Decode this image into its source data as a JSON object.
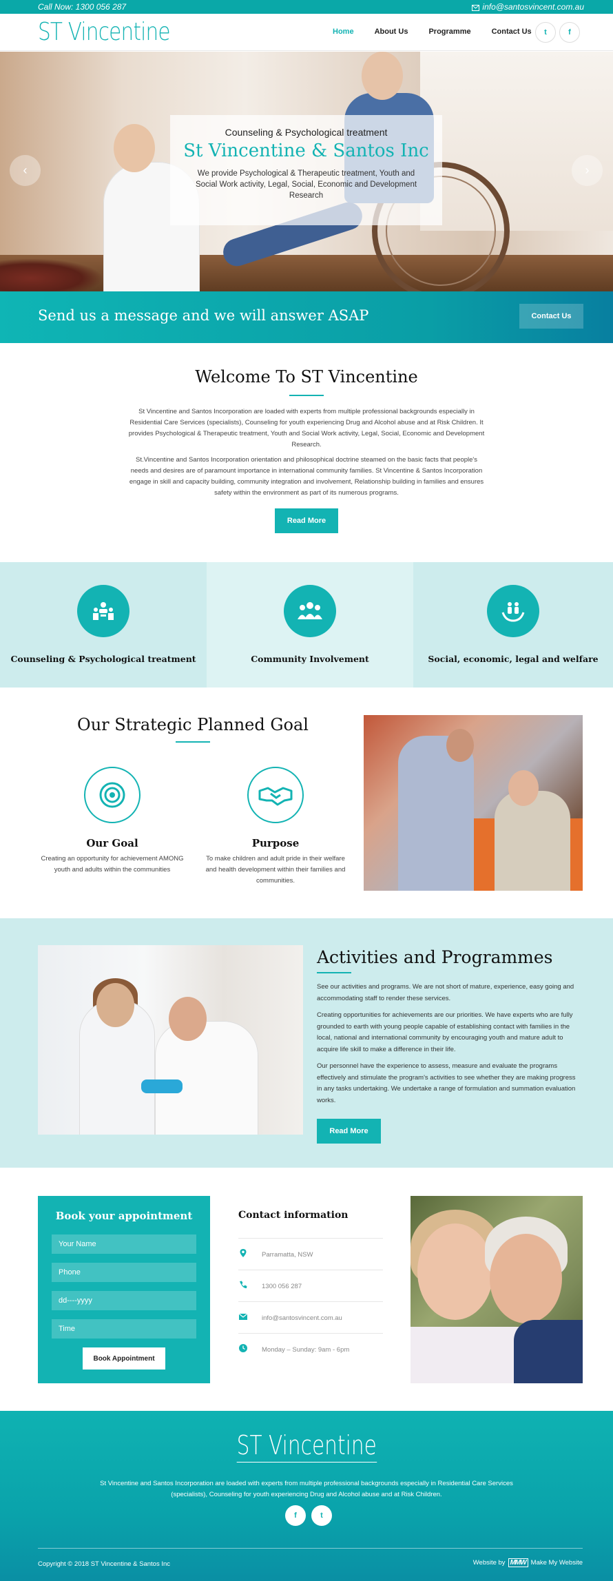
{
  "topbar": {
    "call": "Call Now: 1300 056 287",
    "email": "info@santosvincent.com.au"
  },
  "header": {
    "logo": "ST Vincentine",
    "nav": [
      "Home",
      "About Us",
      "Programme",
      "Contact Us"
    ],
    "active_nav": "Home",
    "social": [
      "twitter-icon",
      "facebook-icon"
    ],
    "social_glyphs": {
      "twitter": "t",
      "facebook": "f"
    }
  },
  "hero": {
    "subtitle": "Counseling & Psychological treatment",
    "title": "St Vincentine & Santos Inc",
    "description": "We provide Psychological & Therapeutic treatment, Youth and Social Work activity, Legal, Social, Economic and Development Research",
    "prev": "‹",
    "next": "›"
  },
  "cta": {
    "message": "Send us a message and we will answer ASAP",
    "button": "Contact Us"
  },
  "welcome": {
    "title": "Welcome To ST Vincentine",
    "p1": "St Vincentine and Santos Incorporation are loaded with experts from multiple professional backgrounds especially in Residential Care Services (specialists), Counseling for youth experiencing Drug and Alcohol abuse and at Risk Children. It provides Psychological & Therapeutic treatment, Youth and Social Work activity, Legal, Social, Economic and Development Research.",
    "p2": "St.Vincentine and Santos Incorporation orientation and philosophical doctrine steamed on the basic facts that people's needs and desires are of paramount importance in international community families. St Vincentine & Santos Incorporation engage in skill and capacity building, community integration and involvement, Relationship building in families and ensures safety within the environment as part of its numerous programs.",
    "button": "Read More"
  },
  "features": [
    {
      "label": "Counseling & Psychological treatment",
      "icon": "counseling-icon"
    },
    {
      "label": "Community Involvement",
      "icon": "community-icon"
    },
    {
      "label": "Social, economic, legal and welfare",
      "icon": "welfare-icon"
    }
  ],
  "goal": {
    "title": "Our Strategic Planned Goal",
    "items": [
      {
        "title": "Our Goal",
        "text": "Creating an opportunity for achievement AMONG youth and adults within the communities",
        "icon": "target-icon"
      },
      {
        "title": "Purpose",
        "text": "To make children and adult pride in their welfare and health development within their families and communities.",
        "icon": "handshake-icon"
      }
    ]
  },
  "activities": {
    "title": "Activities and Programmes",
    "p1": "See our activities and programs. We are not short of mature, experience, easy going and accommodating staff to render these services.",
    "p2": "Creating opportunities for achievements are our priorities. We have experts who are fully grounded to earth with young people capable of establishing contact with families in the local, national and international community by encouraging youth and mature adult to acquire life skill to make a difference in their life.",
    "p3": "Our personnel have the experience to assess, measure and evaluate the programs effectively and stimulate the program's activities to see whether they are making progress in any tasks undertaking. We undertake a range of formulation and summation evaluation works.",
    "button": "Read More"
  },
  "booking": {
    "title": "Book your appointment",
    "fields": [
      "Your Name",
      "Phone",
      "dd----yyyy",
      "Time"
    ],
    "button": "Book Appointment"
  },
  "contact": {
    "title": "Contact information",
    "items": [
      {
        "icon": "location-pin-icon",
        "value": "Parramatta, NSW"
      },
      {
        "icon": "phone-icon",
        "value": "1300 056 287"
      },
      {
        "icon": "envelope-icon",
        "value": "info@santosvincent.com.au"
      },
      {
        "icon": "clock-icon",
        "value": "Monday – Sunday: 9am - 6pm"
      }
    ]
  },
  "footer": {
    "logo": "ST Vincentine",
    "description": "St Vincentine and Santos Incorporation are loaded with experts from multiple professional backgrounds especially in Residential Care Services (specialists), Counseling for youth experiencing Drug and Alcohol abuse and at Risk Children.",
    "social_glyphs": {
      "facebook": "f",
      "twitter": "t"
    },
    "copyright": "Copyright © 2018 ST Vincentine & Santos Inc",
    "website_by": "Website by",
    "mmw_logo": "MMW",
    "maker": "Make My Website"
  },
  "colors": {
    "accent": "#13b3b3",
    "light_teal": "#cdeced",
    "dark": "#111111"
  }
}
